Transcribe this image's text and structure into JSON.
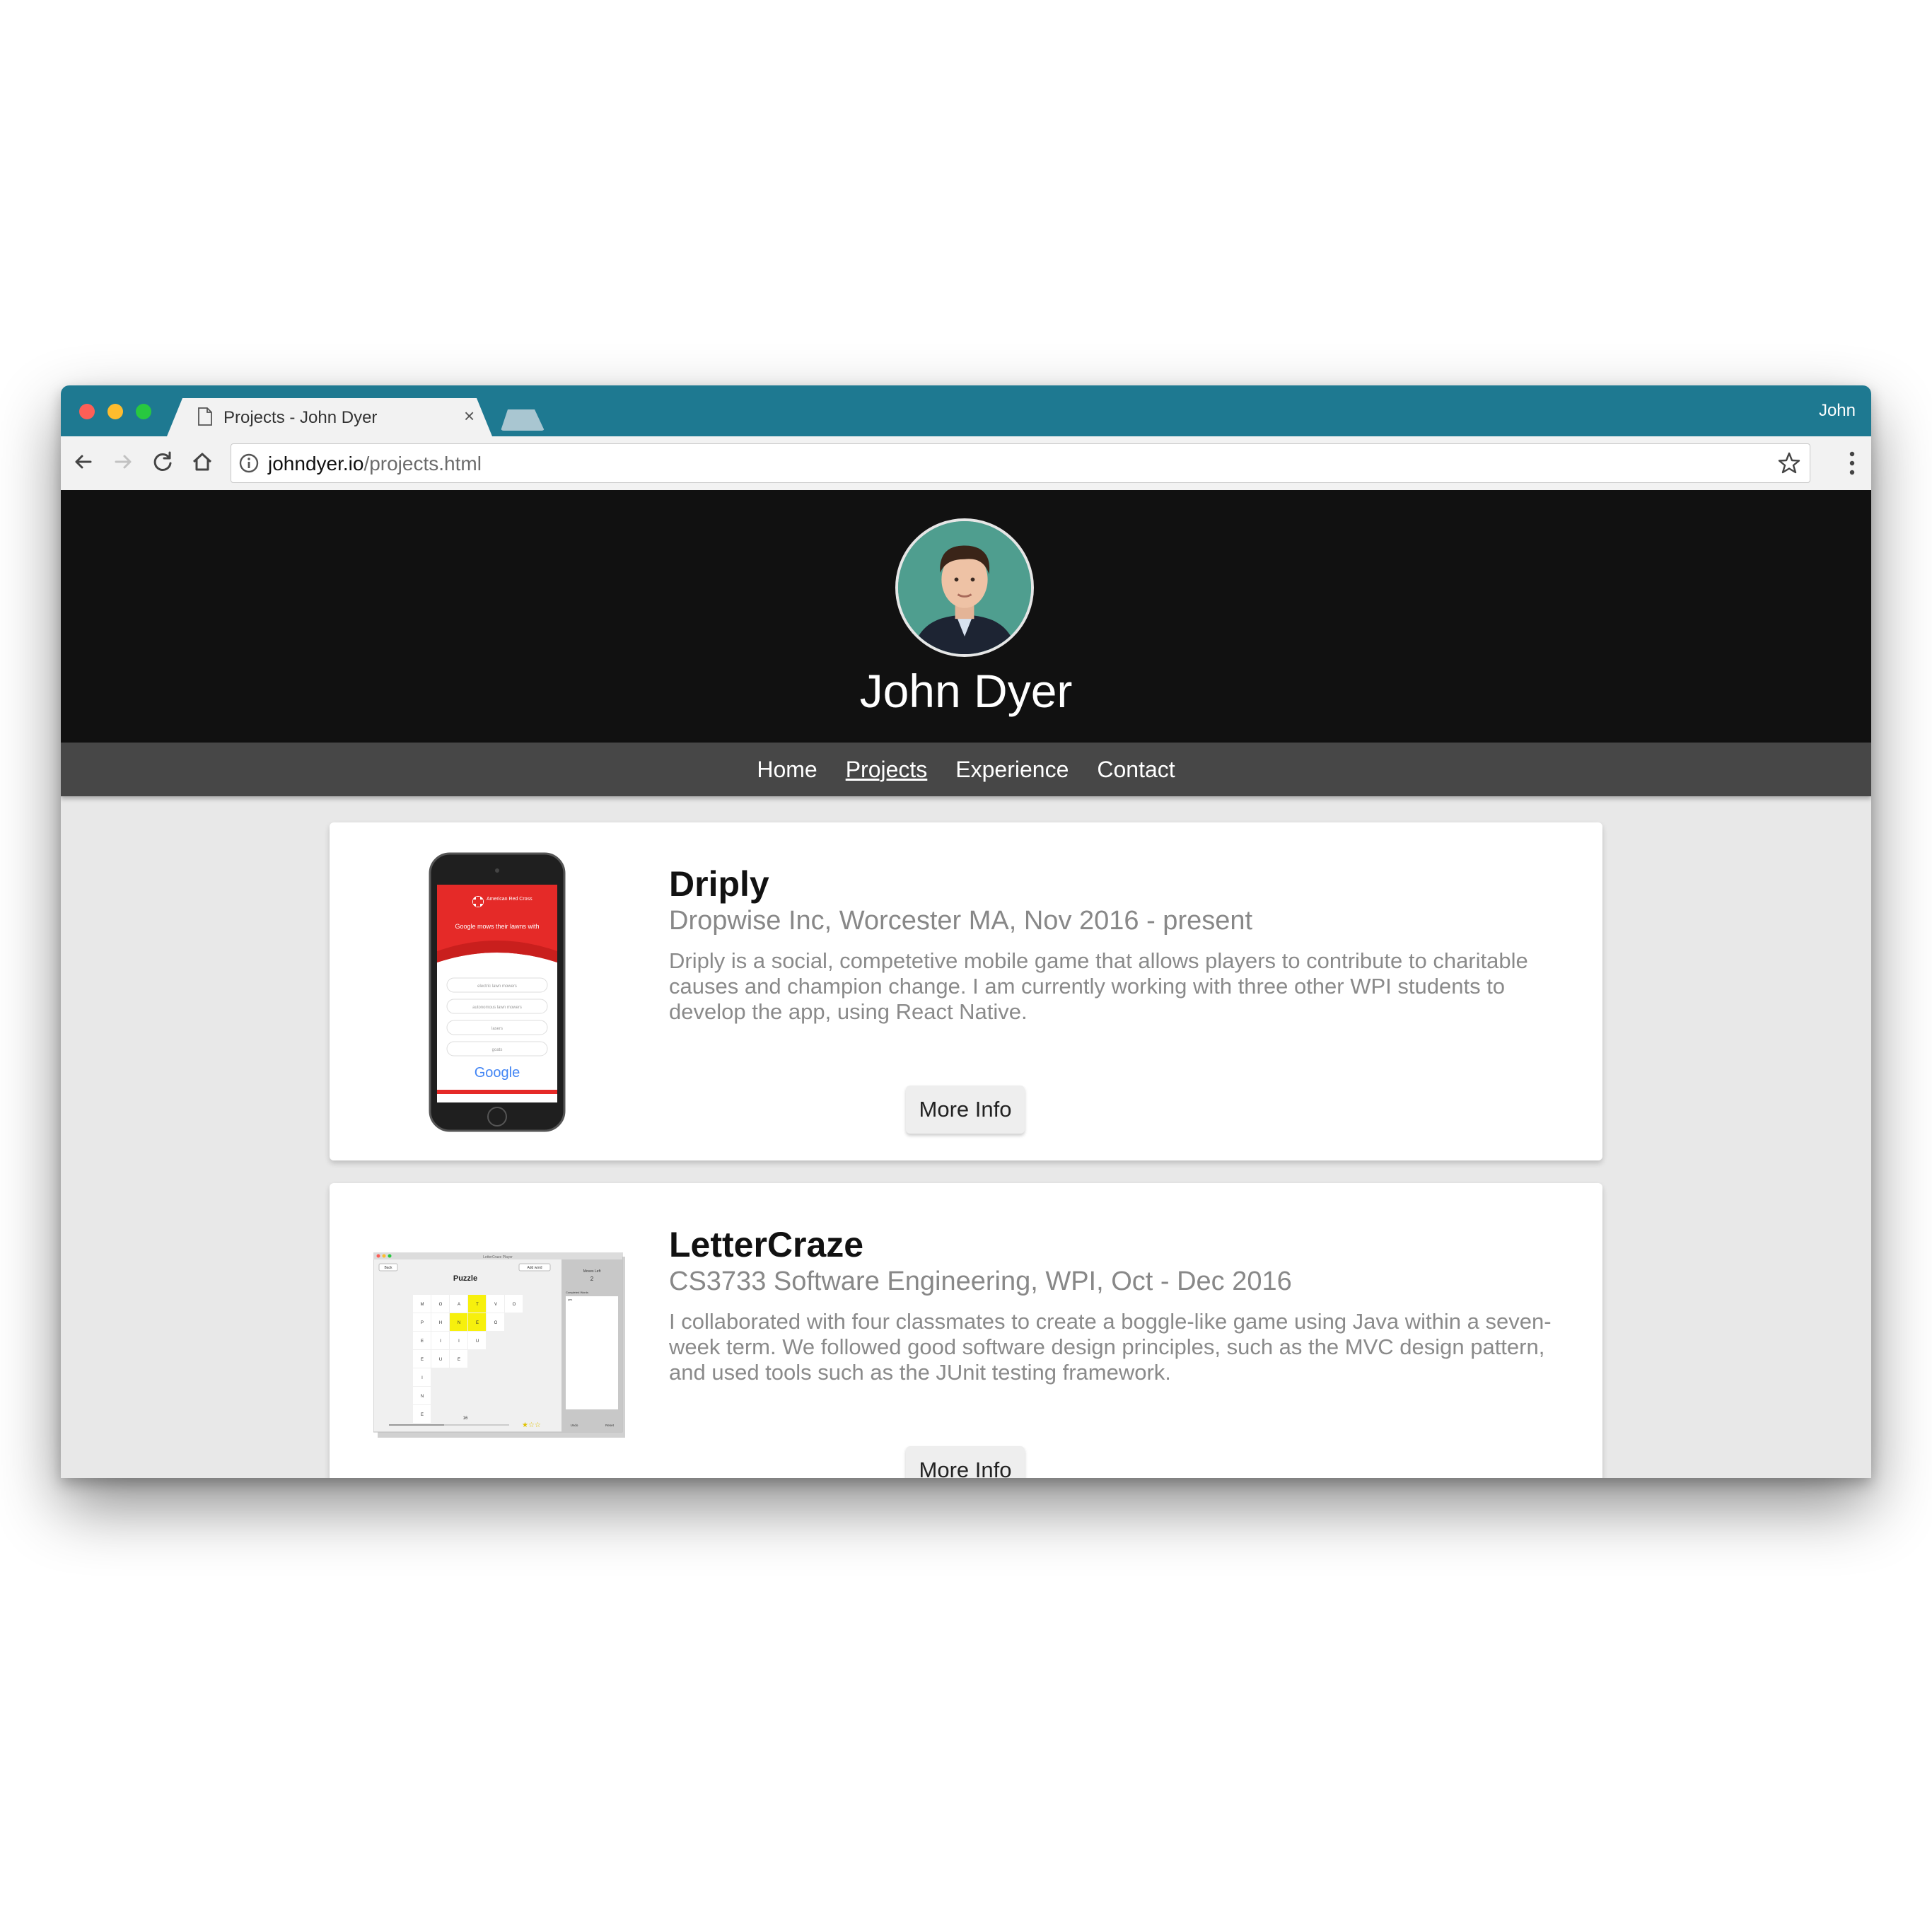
{
  "browser": {
    "tab_title": "Projects - John Dyer",
    "tab_close": "×",
    "profile_name": "John",
    "url_host": "johndyer.io",
    "url_path": "/projects.html"
  },
  "site": {
    "name": "John Dyer",
    "nav": [
      "Home",
      "Projects",
      "Experience",
      "Contact"
    ],
    "active_nav": "Projects"
  },
  "projects": [
    {
      "title": "Driply",
      "subtitle": "Dropwise Inc, Worcester MA, Nov 2016 - present",
      "description": "Driply is a social, competetive mobile game that allows players to contribute to charitable causes and champion change. I am currently working with three other WPI students to develop the app, using React Native.",
      "button": "More Info",
      "thumb": {
        "brand": "American Red Cross",
        "question": "Google mows their lawns with",
        "options": [
          "electric lawn mowers",
          "autonomous lawn mowers",
          "lasers",
          "goats"
        ],
        "footer_logo": "Google"
      }
    },
    {
      "title": "LetterCraze",
      "subtitle": "CS3733 Software Engineering, WPI, Oct - Dec 2016",
      "description": "I collaborated with four classmates to create a boggle-like game using Java within a seven-week term. We followed good software design principles, such as the MVC design pattern, and used tools such as the JUnit testing framework.",
      "button": "More Info",
      "thumb": {
        "window_title": "LetterCraze Player",
        "heading": "Puzzle",
        "moves_label": "Moves Left",
        "moves_value": "2",
        "completed_label": "Completed Words",
        "completed_first": "yes",
        "grid_letters": [
          "M",
          "O",
          "A",
          "T",
          "V",
          "O",
          "P",
          "H",
          "N",
          "E",
          "O",
          "E",
          "I",
          "I",
          "U",
          "E",
          "U",
          "E",
          "I",
          "N",
          "E"
        ],
        "score": "16",
        "back_label": "Back",
        "add_label": "Add word",
        "undo_label": "Undo",
        "reset_label": "Reset"
      }
    }
  ],
  "colors": {
    "tabstrip": "#1e7991",
    "header_bg": "#111111",
    "nav_bg": "#474747",
    "page_bg": "#e8e8e8",
    "card_bg": "#ffffff",
    "red_cross": "#e52a28",
    "highlight_yellow": "#f7f00d"
  },
  "icons": [
    "document-icon",
    "close-icon",
    "back-arrow-icon",
    "forward-arrow-icon",
    "reload-icon",
    "home-icon",
    "info-icon",
    "star-icon",
    "kebab-menu-icon"
  ]
}
